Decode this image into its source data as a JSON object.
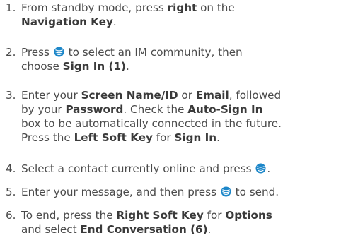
{
  "steps": [
    {
      "number": "1.",
      "lines": [
        [
          {
            "t": "From standby mode, press "
          },
          {
            "b": "right"
          },
          {
            "t": " on the"
          }
        ],
        [
          {
            "b": "Navigation Key"
          },
          {
            "t": "."
          }
        ]
      ]
    },
    {
      "number": "2.",
      "lines": [
        [
          {
            "t": "Press "
          },
          {
            "icon": "navigation-key-icon"
          },
          {
            "t": " to select an IM community, then"
          }
        ],
        [
          {
            "t": "choose "
          },
          {
            "b": "Sign In (1)"
          },
          {
            "t": "."
          }
        ]
      ]
    },
    {
      "number": "3.",
      "lines": [
        [
          {
            "t": "Enter your "
          },
          {
            "b": "Screen Name/ID"
          },
          {
            "t": " or "
          },
          {
            "b": "Email"
          },
          {
            "t": ", followed"
          }
        ],
        [
          {
            "t": "by your "
          },
          {
            "b": "Password"
          },
          {
            "t": ". Check the "
          },
          {
            "b": "Auto-Sign In"
          }
        ],
        [
          {
            "t": "box to be automatically connected in the future."
          }
        ],
        [
          {
            "t": "Press the "
          },
          {
            "b": "Left Soft Key"
          },
          {
            "t": " for "
          },
          {
            "b": "Sign In"
          },
          {
            "t": "."
          }
        ]
      ]
    },
    {
      "number": "4.",
      "lines": [
        [
          {
            "t": "Select a contact currently online and press "
          },
          {
            "icon": "navigation-key-icon"
          },
          {
            "t": "."
          }
        ]
      ]
    },
    {
      "number": "5.",
      "lines": [
        [
          {
            "t": "Enter your message, and then press "
          },
          {
            "icon": "navigation-key-icon"
          },
          {
            "t": " to send."
          }
        ]
      ]
    },
    {
      "number": "6.",
      "lines": [
        [
          {
            "t": "To end, press the "
          },
          {
            "b": "Right Soft Key"
          },
          {
            "t": " for "
          },
          {
            "b": "Options"
          }
        ],
        [
          {
            "t": "and select "
          },
          {
            "b": "End Conversation (6)"
          },
          {
            "t": "."
          }
        ]
      ]
    }
  ],
  "colors": {
    "text": "#4a4a4a",
    "bold_text": "#3a3a3a",
    "icon_blue": "#1d87c9"
  }
}
